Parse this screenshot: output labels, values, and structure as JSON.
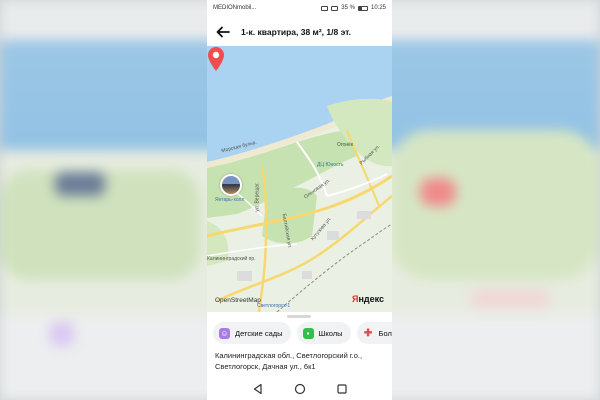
{
  "status_bar": {
    "carrier": "MEDIONmobil...",
    "battery": "35 %",
    "time": "10:25"
  },
  "app_bar": {
    "title": "1-к. квартира, 38 м², 1/8 эт."
  },
  "map": {
    "labels": {
      "street_morskaya": "Морская бульв.",
      "park_ogon": "Огонёк",
      "dk_yunost": "ДЦ Юность",
      "street_rybnaya": "Рыбная ул.",
      "street_olkhovaya": "Ольховая ул.",
      "street_veresch": "ул. Верещаг.",
      "street_baltiyskaya": "Балтийская ул.",
      "street_kutuzova": "Кутузова ул.",
      "street_kaliningrad": "Калининградский пр.",
      "place_yantar": "Янтарь-холл",
      "station": "Светлогорск-1"
    },
    "attribution": "OpenStreetMap",
    "brand_ya": "Я",
    "brand_rest": "ндекс",
    "colors": {
      "sea": "#a9d3f1",
      "park": "#c6e2b0",
      "road": "#f7d86e",
      "pin": "#f04e4e"
    }
  },
  "sheet": {
    "chips": [
      {
        "label": "Детские сады",
        "icon": "kindergarten-icon",
        "color": "#a77be8"
      },
      {
        "label": "Школы",
        "icon": "school-icon",
        "color": "#2fbf4a"
      },
      {
        "label": "Бол",
        "icon": "hospital-icon",
        "color": "#e24d4d"
      }
    ],
    "address": "Калининградская обл., Светлогорский г.о., Светлогорск, Дачная ул., 6к1"
  }
}
